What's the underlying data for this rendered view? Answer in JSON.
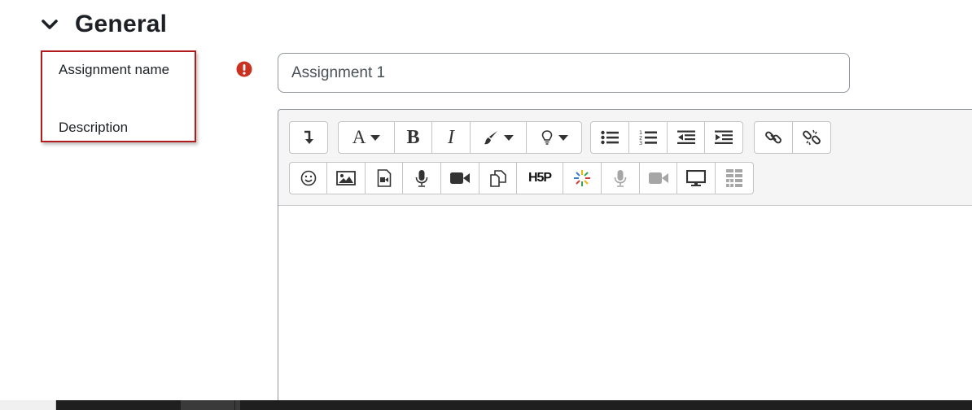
{
  "section": {
    "title": "General",
    "collapse_icon": "chevron-down-icon"
  },
  "form": {
    "assignment_name_label": "Assignment name",
    "description_label": "Description",
    "assignment_name_value": "Assignment 1",
    "required_icon": "exclamation-circle-icon",
    "required_color": "#ca3120",
    "highlight_color": "#b01c1c"
  },
  "editor": {
    "toolbar_row1": [
      "show-more-icon",
      "font-style-icon",
      "bold-icon",
      "italic-icon",
      "text-color-icon",
      "lightbulb-icon",
      "unordered-list-icon",
      "ordered-list-icon",
      "outdent-icon",
      "indent-icon",
      "link-icon",
      "unlink-icon"
    ],
    "toolbar_row2": [
      "emoji-icon",
      "image-icon",
      "media-icon",
      "record-audio-icon",
      "record-video-icon",
      "manage-files-icon",
      "h5p-icon",
      "sparkle-icon",
      "record-audio-disabled-icon",
      "record-video-disabled-icon",
      "screen-icon",
      "table-icon"
    ],
    "glyphs": {
      "font": "A",
      "bold": "B",
      "italic": "I",
      "h5p": "H5P"
    }
  }
}
